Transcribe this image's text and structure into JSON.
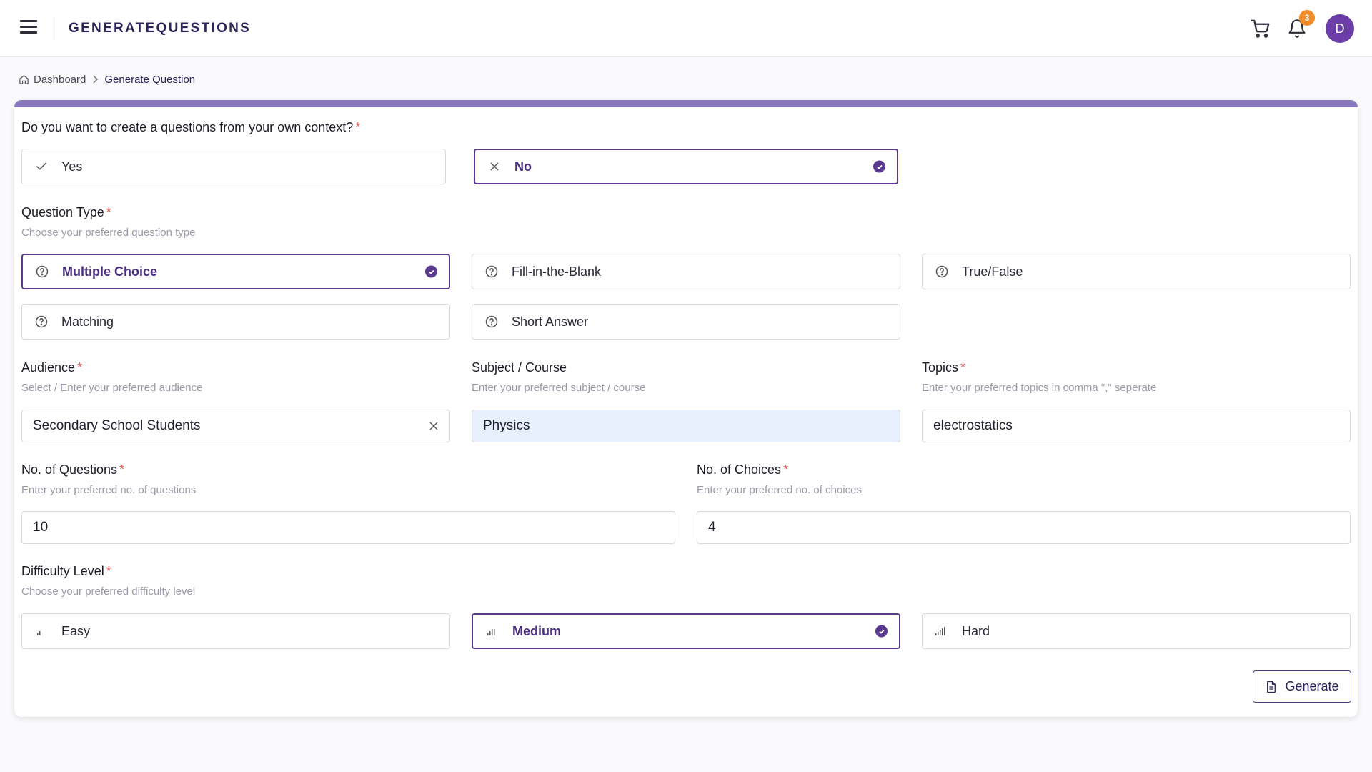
{
  "header": {
    "brand": "GENERATEQUESTIONS",
    "notification_count": "3",
    "avatar_initial": "D"
  },
  "breadcrumb": {
    "home": "Dashboard",
    "current": "Generate Question"
  },
  "context": {
    "question": "Do you want to create a questions from your own context?",
    "options": [
      {
        "label": "Yes",
        "selected": false
      },
      {
        "label": "No",
        "selected": true
      }
    ]
  },
  "question_type": {
    "label": "Question Type",
    "hint": "Choose your preferred question type",
    "options": [
      {
        "label": "Multiple Choice",
        "selected": true
      },
      {
        "label": "Fill-in-the-Blank",
        "selected": false
      },
      {
        "label": "True/False",
        "selected": false
      },
      {
        "label": "Matching",
        "selected": false
      },
      {
        "label": "Short Answer",
        "selected": false
      }
    ]
  },
  "audience": {
    "label": "Audience",
    "hint": "Select / Enter your preferred audience",
    "value": "Secondary School Students"
  },
  "subject": {
    "label": "Subject / Course",
    "hint": "Enter your preferred subject / course",
    "value": "Physics"
  },
  "topics": {
    "label": "Topics",
    "hint": "Enter your preferred topics in comma \",\" seperate",
    "value": "electrostatics"
  },
  "num_questions": {
    "label": "No. of Questions",
    "hint": "Enter your preferred no. of questions",
    "value": "10"
  },
  "num_choices": {
    "label": "No. of Choices",
    "hint": "Enter your preferred no. of choices",
    "value": "4"
  },
  "difficulty": {
    "label": "Difficulty Level",
    "hint": "Choose your preferred difficulty level",
    "options": [
      {
        "label": "Easy",
        "selected": false
      },
      {
        "label": "Medium",
        "selected": true
      },
      {
        "label": "Hard",
        "selected": false
      }
    ]
  },
  "generate_label": "Generate",
  "required_mark": "*",
  "colors": {
    "accent": "#5b3a8f",
    "topline": "#8a78bd",
    "badge": "#f08c2a",
    "avatar": "#6a3ea6",
    "required": "#e05555"
  }
}
